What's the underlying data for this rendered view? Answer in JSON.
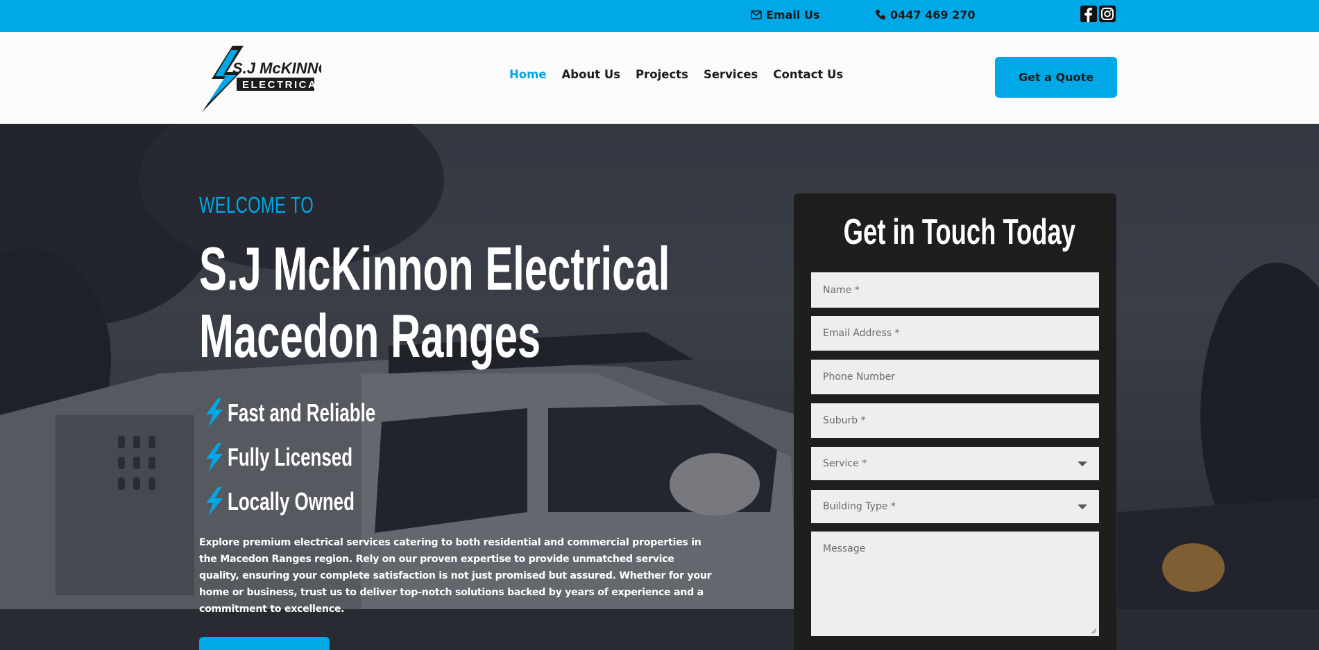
{
  "topbar": {
    "email_label": "Email Us",
    "phone_label": "0447 469 270",
    "social": [
      "facebook-icon",
      "instagram-icon"
    ]
  },
  "header": {
    "logo_line1": "S.J McKINNON",
    "logo_line2": "ELECTRICAL",
    "nav": [
      {
        "label": "Home",
        "active": true
      },
      {
        "label": "About Us",
        "active": false
      },
      {
        "label": "Projects",
        "active": false
      },
      {
        "label": "Services",
        "active": false
      },
      {
        "label": "Contact Us",
        "active": false
      }
    ],
    "cta_label": "Get a Quote"
  },
  "hero": {
    "eyebrow": "WELCOME TO",
    "title_line1": "S.J McKinnon Electrical",
    "title_line2": "Macedon Ranges",
    "features": [
      "Fast and Reliable",
      "Fully Licensed",
      "Locally Owned"
    ],
    "description": "Explore premium electrical services catering to both residential and commercial properties in the Macedon Ranges region. Rely on our proven expertise to provide unmatched service quality, ensuring your complete satisfaction is not just promised but assured. Whether for your home or business, trust us to deliver top-notch solutions backed by years of experience and a commitment to excellence."
  },
  "form": {
    "title": "Get in Touch Today",
    "name_placeholder": "Name *",
    "email_placeholder": "Email Address *",
    "phone_placeholder": "Phone Number",
    "suburb_placeholder": "Suburb *",
    "service_placeholder": "Service *",
    "building_placeholder": "Building Type *",
    "message_placeholder": "Message"
  },
  "colors": {
    "accent": "#00a8e8",
    "dark": "#1f1e1f",
    "text": "#1c1c1c"
  }
}
